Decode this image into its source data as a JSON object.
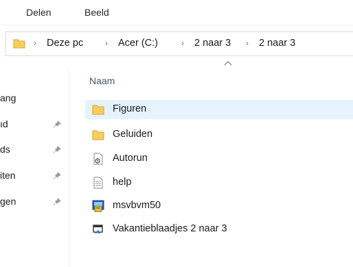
{
  "ribbon": {
    "tabs": [
      "Delen",
      "Beeld"
    ]
  },
  "address": {
    "crumbs": [
      "Deze pc",
      "Acer (C:)",
      "2 naar 3",
      "2 naar 3"
    ]
  },
  "nav": {
    "items": [
      {
        "label": "ang",
        "pinned": false
      },
      {
        "label": "ıd",
        "pinned": true
      },
      {
        "label": "ds",
        "pinned": true
      },
      {
        "label": "iten",
        "pinned": true
      },
      {
        "label": "gen",
        "pinned": true
      }
    ]
  },
  "list": {
    "column_name": "Naam",
    "files": [
      {
        "name": "Figuren",
        "icon": "folder-icon",
        "selected": true
      },
      {
        "name": "Geluiden",
        "icon": "folder-icon",
        "selected": false
      },
      {
        "name": "Autorun",
        "icon": "settings-file-icon",
        "selected": false
      },
      {
        "name": "help",
        "icon": "text-file-icon",
        "selected": false
      },
      {
        "name": "msvbvm50",
        "icon": "installer-icon",
        "selected": false
      },
      {
        "name": "Vakantieblaadjes 2 naar 3",
        "icon": "shortcut-icon",
        "selected": false
      }
    ]
  }
}
